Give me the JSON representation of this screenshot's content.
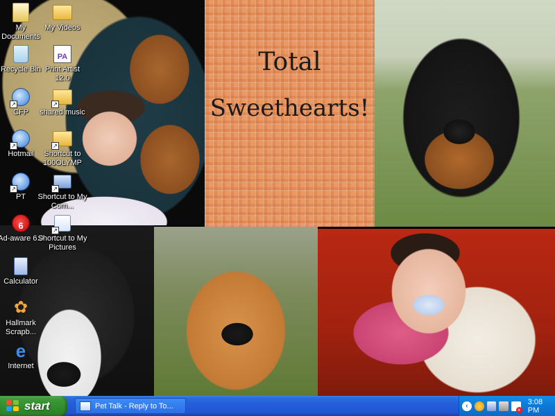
{
  "wallpaper": {
    "title_line1": "Total",
    "title_line2": "Sweethearts!"
  },
  "desktop_icons": [
    {
      "label": "My Documents",
      "icon": "my-documents-icon"
    },
    {
      "label": "My Videos",
      "icon": "my-videos-folder-icon"
    },
    {
      "label": "Recycle Bin",
      "icon": "recycle-bin-icon"
    },
    {
      "label": "Print Artist 12.0",
      "icon": "print-artist-icon"
    },
    {
      "label": "CFP",
      "icon": "web-shortcut-icon"
    },
    {
      "label": "shared music",
      "icon": "folder-icon"
    },
    {
      "label": "Hotmail",
      "icon": "web-shortcut-icon"
    },
    {
      "label": "Shortcut to 100OLYMP",
      "icon": "folder-icon"
    },
    {
      "label": "PT",
      "icon": "web-shortcut-icon"
    },
    {
      "label": "Shortcut to My Com...",
      "icon": "my-computer-icon"
    },
    {
      "label": "Ad-aware 6.0",
      "icon": "ad-aware-icon"
    },
    {
      "label": "Shortcut to My Pictures",
      "icon": "my-pictures-icon"
    },
    {
      "label": "Calculator",
      "icon": "calculator-icon"
    },
    {
      "label": "Hallmark Scrapb...",
      "icon": "hallmark-icon"
    },
    {
      "label": "Internet",
      "icon": "internet-explorer-icon"
    }
  ],
  "taskbar": {
    "start_label": "start",
    "task_label": "Pet Talk - Reply to To...",
    "clock": "3:08 PM"
  }
}
